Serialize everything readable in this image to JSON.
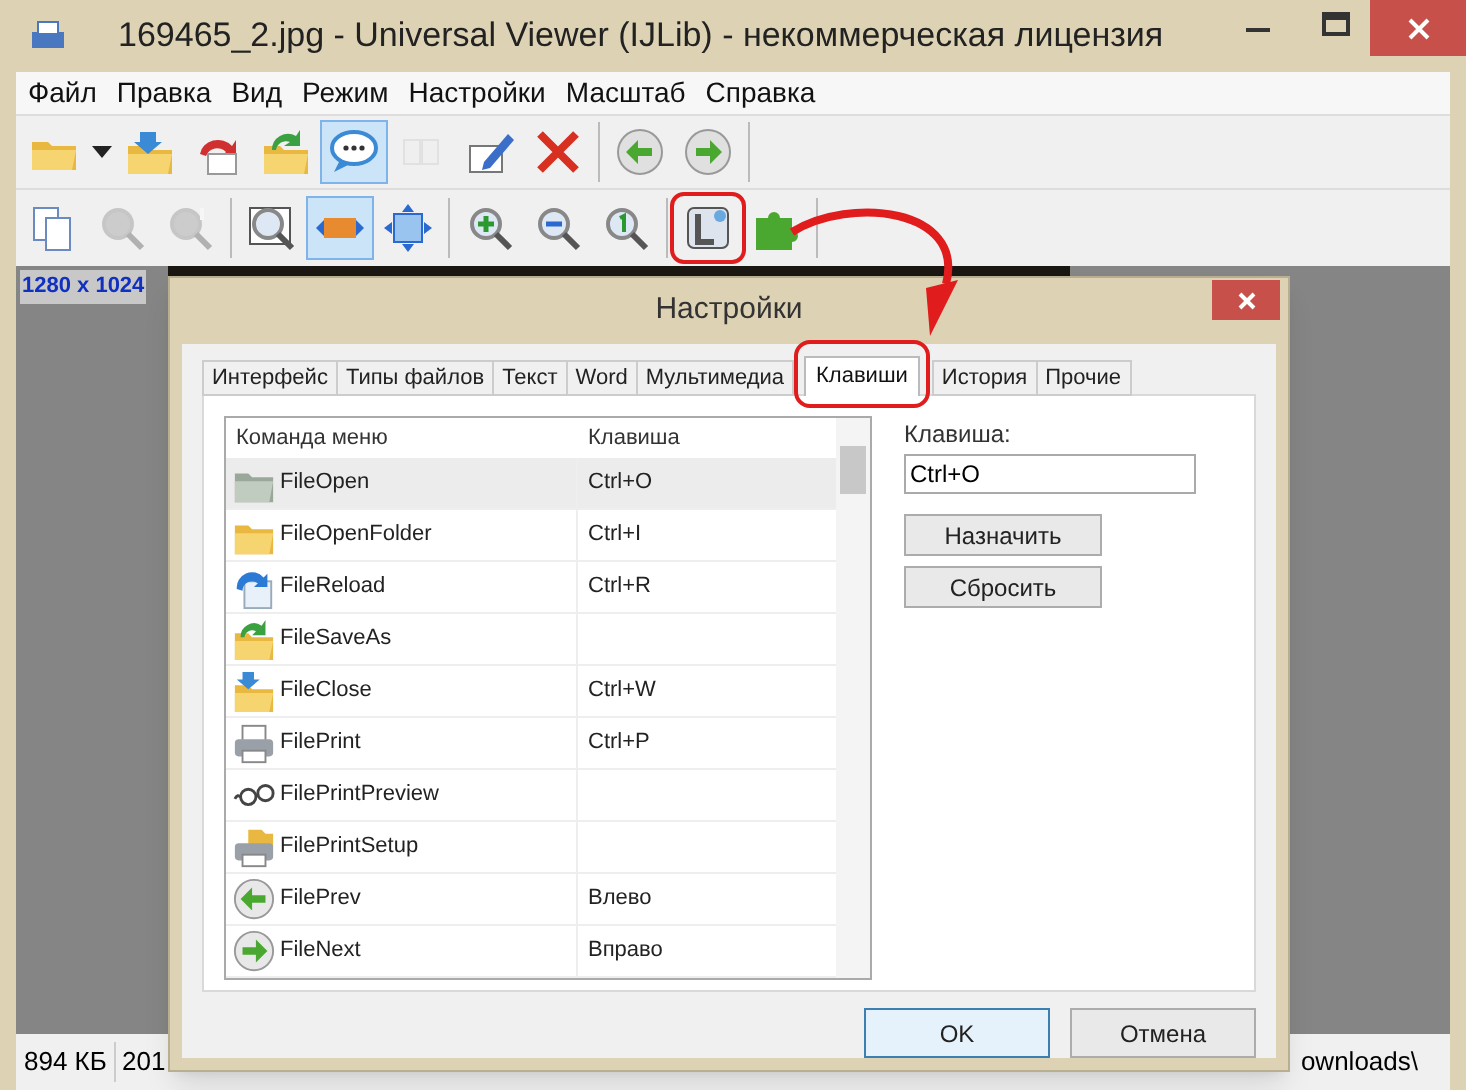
{
  "window": {
    "title": "169465_2.jpg - Universal Viewer (IJLib) - некоммерческая лицензия"
  },
  "menu": [
    "Файл",
    "Правка",
    "Вид",
    "Режим",
    "Настройки",
    "Масштаб",
    "Справка"
  ],
  "toolbar_1": [
    {
      "kind": "button",
      "pressed": false,
      "disabled": false
    },
    {
      "kind": "dropdown",
      "pressed": false,
      "disabled": false
    },
    {
      "kind": "button",
      "pressed": false,
      "disabled": false
    },
    {
      "kind": "button",
      "pressed": false,
      "disabled": false
    },
    {
      "kind": "button",
      "pressed": false,
      "disabled": false
    },
    {
      "kind": "button",
      "pressed": true,
      "disabled": false
    },
    {
      "kind": "button",
      "pressed": false,
      "disabled": true
    },
    {
      "kind": "button",
      "pressed": false,
      "disabled": false
    },
    {
      "kind": "button",
      "pressed": false,
      "disabled": false
    },
    {
      "kind": "separator"
    },
    {
      "kind": "button",
      "pressed": false,
      "disabled": false
    },
    {
      "kind": "button",
      "pressed": false,
      "disabled": false
    },
    {
      "kind": "separator"
    }
  ],
  "toolbar_2": [
    {
      "kind": "button",
      "pressed": false,
      "disabled": false,
      "highlighted": false
    },
    {
      "kind": "button",
      "pressed": false,
      "disabled": true,
      "highlighted": false
    },
    {
      "kind": "button",
      "pressed": false,
      "disabled": true,
      "highlighted": false
    },
    {
      "kind": "separator"
    },
    {
      "kind": "button",
      "pressed": false,
      "disabled": false,
      "highlighted": false
    },
    {
      "kind": "button",
      "pressed": true,
      "disabled": false,
      "highlighted": false
    },
    {
      "kind": "button",
      "pressed": false,
      "disabled": false,
      "highlighted": false
    },
    {
      "kind": "separator"
    },
    {
      "kind": "button",
      "pressed": false,
      "disabled": false,
      "highlighted": false
    },
    {
      "kind": "button",
      "pressed": false,
      "disabled": false,
      "highlighted": false
    },
    {
      "kind": "button",
      "pressed": false,
      "disabled": false,
      "highlighted": false
    },
    {
      "kind": "separator"
    },
    {
      "kind": "button",
      "pressed": false,
      "disabled": false,
      "highlighted": true
    },
    {
      "kind": "button",
      "pressed": false,
      "disabled": false,
      "highlighted": false
    },
    {
      "kind": "separator"
    }
  ],
  "image_info": "1280 x 1024",
  "status_bar": [
    "894 КБ",
    "201",
    "ownloads\\"
  ],
  "dialog": {
    "title": "Настройки",
    "tabs": [
      {
        "label": "Интерфейс",
        "selected": false,
        "highlighted": false
      },
      {
        "label": "Типы файлов",
        "selected": false,
        "highlighted": false
      },
      {
        "label": "Текст",
        "selected": false,
        "highlighted": false
      },
      {
        "label": "Word",
        "selected": false,
        "highlighted": false
      },
      {
        "label": "Мультимедиа",
        "selected": false,
        "highlighted": false
      },
      {
        "label": "Клавиши",
        "selected": true,
        "highlighted": true
      },
      {
        "label": "История",
        "selected": false,
        "highlighted": false
      },
      {
        "label": "Прочие",
        "selected": false,
        "highlighted": false
      }
    ],
    "table": {
      "columns": [
        "Команда меню",
        "Клавиша"
      ],
      "rows": [
        {
          "command": "FileOpen",
          "key": "Ctrl+O",
          "selected": true
        },
        {
          "command": "FileOpenFolder",
          "key": "Ctrl+I",
          "selected": false
        },
        {
          "command": "FileReload",
          "key": "Ctrl+R",
          "selected": false
        },
        {
          "command": "FileSaveAs",
          "selected": false
        },
        {
          "command": "FileClose",
          "key": "Ctrl+W",
          "selected": false
        },
        {
          "command": "FilePrint",
          "key": "Ctrl+P",
          "selected": false
        },
        {
          "command": "FilePrintPreview",
          "selected": false
        },
        {
          "command": "FilePrintSetup",
          "selected": false
        },
        {
          "command": "FilePrev",
          "key": "Влево",
          "selected": false
        },
        {
          "command": "FileNext",
          "key": "Вправо",
          "selected": false
        }
      ]
    },
    "key_label": "Клавиша:",
    "key_value": "Ctrl+O",
    "side_buttons": [
      "Назначить",
      "Сбросить"
    ],
    "buttons": [
      "OK",
      "Отмена"
    ]
  }
}
